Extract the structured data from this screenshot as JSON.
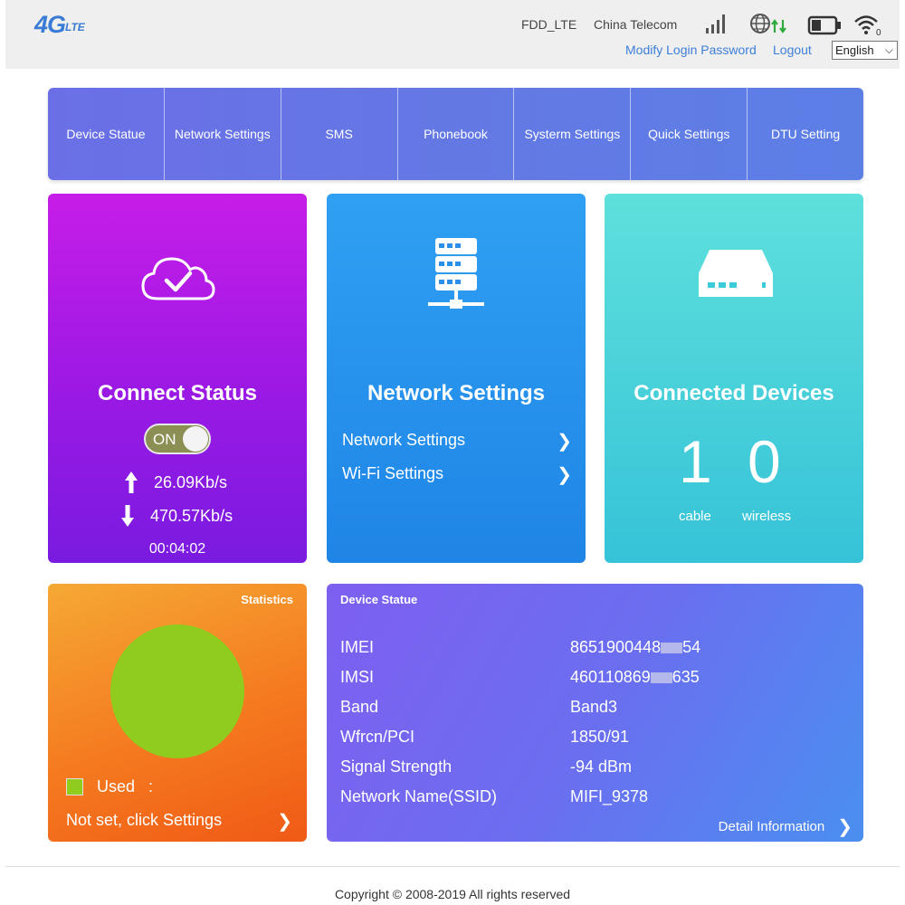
{
  "header": {
    "logo_main": "4G",
    "logo_sub": "LTE",
    "network_type": "FDD_LTE",
    "carrier": "China Telecom",
    "modify_password": "Modify Login Password",
    "logout": "Logout",
    "language": "English"
  },
  "nav": {
    "items": [
      "Device Statue",
      "Network Settings",
      "SMS",
      "Phonebook",
      "Systerm Settings",
      "Quick Settings",
      "DTU Setting"
    ]
  },
  "connect": {
    "title": "Connect Status",
    "toggle_label": "ON",
    "upload_rate": "26.09Kb/s",
    "download_rate": "470.57Kb/s",
    "duration": "00:04:02"
  },
  "network": {
    "title": "Network Settings",
    "links": [
      "Network Settings",
      "Wi-Fi Settings"
    ]
  },
  "devices": {
    "title": "Connected Devices",
    "cable_count": "1",
    "wireless_count": "0",
    "cable_label": "cable",
    "wireless_label": "wireless"
  },
  "statistics": {
    "title": "Statistics",
    "used_label": "Used",
    "used_sep": ":",
    "not_set": "Not set, click Settings"
  },
  "device_status": {
    "title": "Device Statue",
    "rows": [
      {
        "key": "IMEI",
        "value_a": "8651900448",
        "value_b": "54"
      },
      {
        "key": "IMSI",
        "value_a": "460110869",
        "value_b": "635"
      },
      {
        "key": "Band",
        "value_a": "Band3",
        "value_b": ""
      },
      {
        "key": "Wfrcn/PCI",
        "value_a": "1850/91",
        "value_b": ""
      },
      {
        "key": "Signal Strength",
        "value_a": "-94 dBm",
        "value_b": ""
      },
      {
        "key": "Network Name(SSID)",
        "value_a": "MIFI_9378",
        "value_b": ""
      }
    ],
    "detail_link": "Detail Information"
  },
  "footer": {
    "copyright": "Copyright © 2008-2019 All rights reserved"
  },
  "colors": {
    "accent_link": "#3d7fd9",
    "pie_used": "#8fcc1e",
    "signal_arrows": "#2eaa3c"
  }
}
